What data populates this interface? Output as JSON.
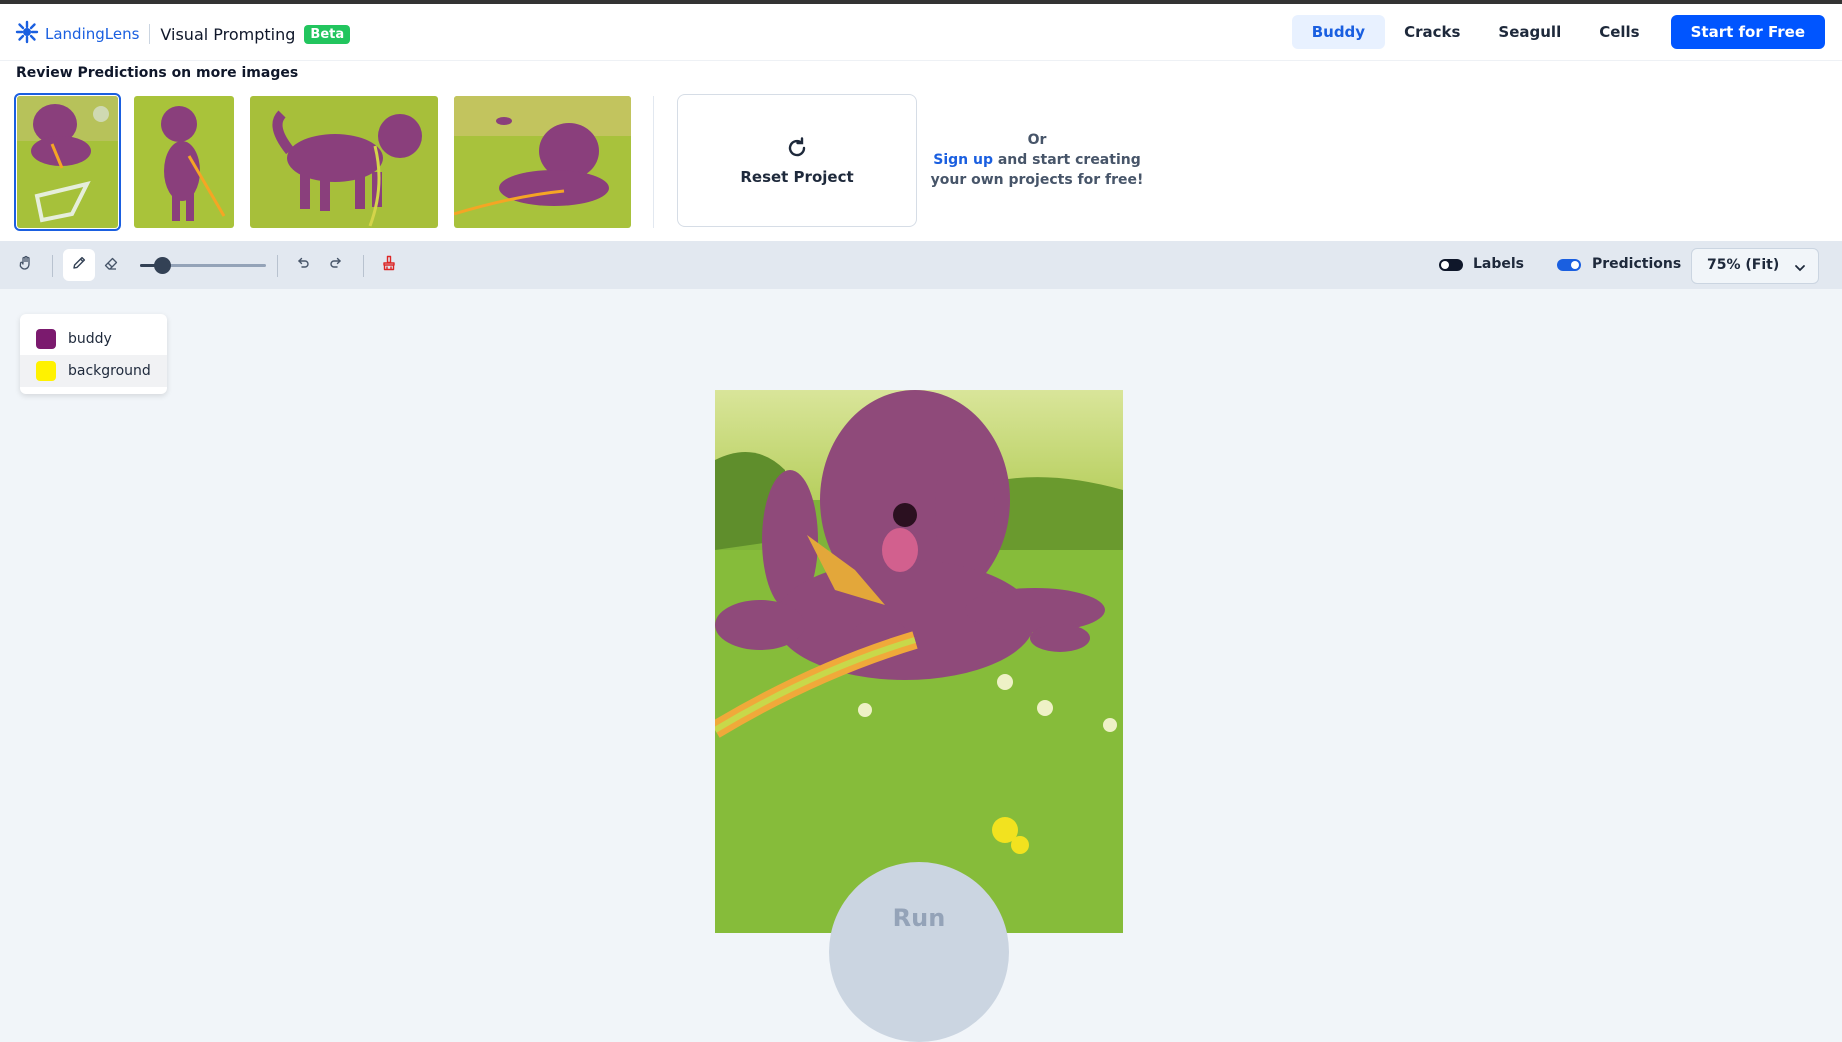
{
  "header": {
    "brand": "LandingLens",
    "app_title": "Visual Prompting",
    "badge": "Beta",
    "nav": [
      "Buddy",
      "Cracks",
      "Seagull",
      "Cells"
    ],
    "active_nav": "Buddy",
    "cta": "Start for Free"
  },
  "review": {
    "title": "Review Predictions on more images",
    "thumbnails": [
      "thumbnail-1",
      "thumbnail-2",
      "thumbnail-3",
      "thumbnail-4"
    ],
    "selected_index": 0,
    "reset_label": "Reset Project",
    "or_text": "Or",
    "signup_link": "Sign up",
    "signup_rest_line1": " and start creating",
    "signup_line2": "your own projects for free!"
  },
  "toolbar": {
    "brush_size_fraction": 0.18,
    "labels_label": "Labels",
    "labels_on": false,
    "predictions_label": "Predictions",
    "predictions_on": true,
    "zoom": "75% (Fit)"
  },
  "legend": {
    "items": [
      {
        "label": "buddy",
        "color": "#7b1a6e"
      },
      {
        "label": "background",
        "color": "#fff200"
      }
    ],
    "highlighted_index": 1
  },
  "run_label": "Run",
  "colors": {
    "accent": "#1a5fe0",
    "cta": "#0055ff",
    "beta": "#22c55e",
    "toggle_off": "#0f172a",
    "toggle_on": "#1a5fe0"
  }
}
